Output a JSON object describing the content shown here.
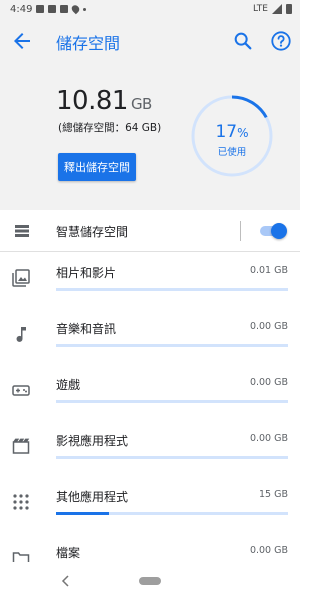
{
  "status_bar": {
    "time": "4:49",
    "network": "LTE"
  },
  "app_bar": {
    "title": "儲存空間"
  },
  "summary": {
    "used_value": "10.81",
    "used_unit": "GB",
    "total_text": "(總儲存空間：64 GB)",
    "free_button_label": "釋出儲存空間",
    "percent_value": "17",
    "percent_sign": "%",
    "percent_label": "已使用",
    "percent_used": 17
  },
  "smart_storage": {
    "label": "智慧儲存空間",
    "enabled": true
  },
  "categories": [
    {
      "label": "相片和影片",
      "size": "0.01 GB",
      "fill_fraction": 0.0,
      "icon": "photo-icon"
    },
    {
      "label": "音樂和音訊",
      "size": "0.00 GB",
      "fill_fraction": 0.0,
      "icon": "music-note-icon"
    },
    {
      "label": "遊戲",
      "size": "0.00 GB",
      "fill_fraction": 0.0,
      "icon": "gamepad-icon"
    },
    {
      "label": "影視應用程式",
      "size": "0.00 GB",
      "fill_fraction": 0.0,
      "icon": "movie-icon"
    },
    {
      "label": "其他應用程式",
      "size": "15 GB",
      "fill_fraction": 0.23,
      "icon": "apps-grid-icon"
    },
    {
      "label": "檔案",
      "size": "0.00 GB",
      "fill_fraction": 0.0,
      "icon": "folder-icon"
    }
  ],
  "colors": {
    "accent": "#1a73e8",
    "bar_track": "#d2e3fc",
    "header_bg": "#f2f2f2"
  }
}
